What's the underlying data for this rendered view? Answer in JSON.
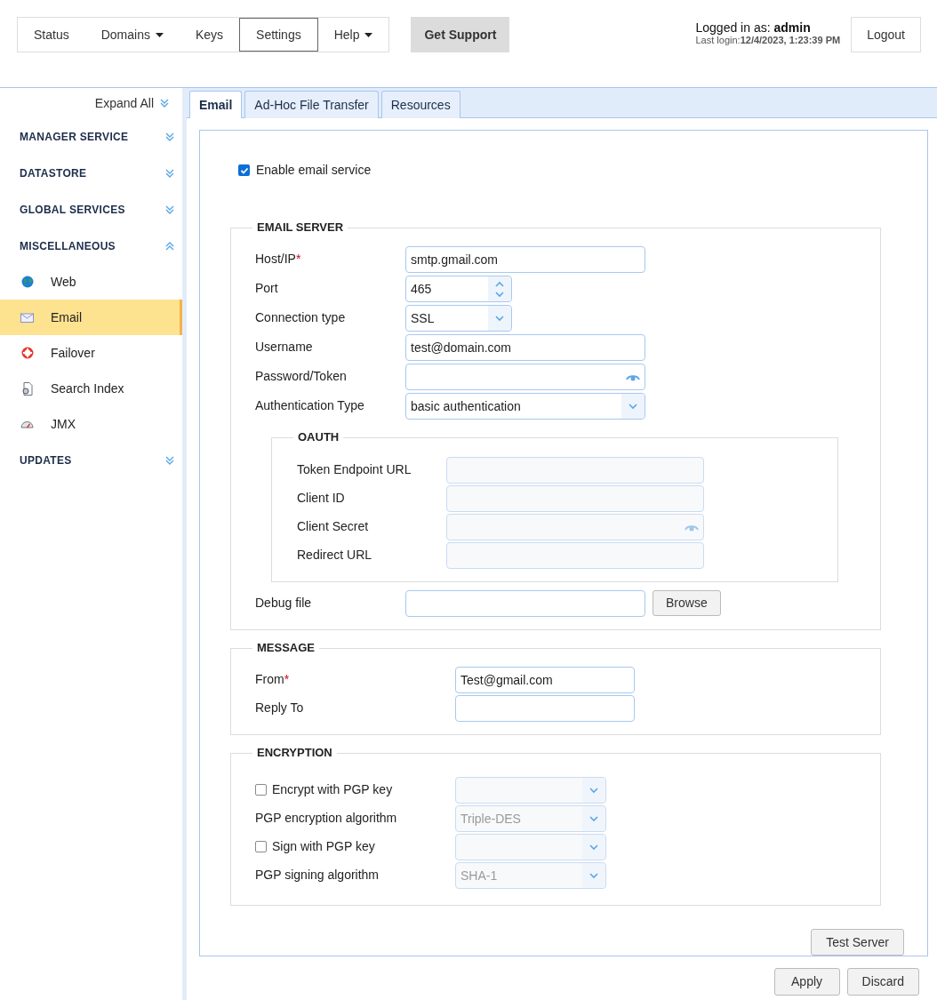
{
  "nav": {
    "items": [
      {
        "label": "Status",
        "selected": false,
        "menu": false
      },
      {
        "label": "Domains",
        "selected": false,
        "menu": true
      },
      {
        "label": "Keys",
        "selected": false,
        "menu": false
      },
      {
        "label": "Settings",
        "selected": true,
        "menu": false
      },
      {
        "label": "Help",
        "selected": false,
        "menu": true
      }
    ],
    "support": "Get Support"
  },
  "user": {
    "prefix": "Logged in as:",
    "name": "admin",
    "login_label": "Last login:",
    "login_time": "12/4/2023, 1:23:39 PM",
    "logout": "Logout"
  },
  "sidebar": {
    "expand_all": "Expand All",
    "sections": [
      {
        "title": "MANAGER SERVICE",
        "expanded": false
      },
      {
        "title": "DATASTORE",
        "expanded": false
      },
      {
        "title": "GLOBAL SERVICES",
        "expanded": false
      },
      {
        "title": "MISCELLANEOUS",
        "expanded": true,
        "items": [
          {
            "label": "Web",
            "selected": false
          },
          {
            "label": "Email",
            "selected": true
          },
          {
            "label": "Failover",
            "selected": false
          },
          {
            "label": "Search Index",
            "selected": false
          },
          {
            "label": "JMX",
            "selected": false
          }
        ]
      },
      {
        "title": "UPDATES",
        "expanded": false
      }
    ]
  },
  "required_mark": "*",
  "tabs": [
    {
      "label": "Email",
      "selected": true
    },
    {
      "label": "Ad-Hoc File Transfer",
      "selected": false
    },
    {
      "label": "Resources",
      "selected": false
    }
  ],
  "enable": {
    "label": "Enable email service",
    "checked": true
  },
  "email_server": {
    "legend": "EMAIL SERVER",
    "fields": [
      {
        "label": "Host/IP",
        "required": true,
        "kind": "text",
        "value": "smtp.gmail.com",
        "disabled": false
      },
      {
        "label": "Port",
        "required": false,
        "kind": "spinner",
        "value": "465",
        "disabled": false
      },
      {
        "label": "Connection type",
        "required": false,
        "kind": "short_select",
        "value": "SSL",
        "disabled": false
      },
      {
        "label": "Username",
        "required": false,
        "kind": "text",
        "value": "test@domain.com",
        "disabled": false
      },
      {
        "label": "Password/Token",
        "required": false,
        "kind": "password",
        "disabled": false
      },
      {
        "label": "Authentication Type",
        "required": false,
        "kind": "select",
        "value": "basic authentication",
        "disabled": false
      }
    ],
    "oauth": {
      "legend": "OAUTH",
      "fields": [
        {
          "label": "Token Endpoint URL",
          "required": false,
          "kind": "text",
          "disabled": true
        },
        {
          "label": "Client ID",
          "required": false,
          "kind": "text",
          "disabled": true
        },
        {
          "label": "Client Secret",
          "required": false,
          "kind": "password",
          "disabled": true
        },
        {
          "label": "Redirect URL",
          "required": false,
          "kind": "text",
          "disabled": true
        }
      ]
    },
    "debug_file": {
      "label": "Debug file",
      "button": "Browse"
    }
  },
  "message": {
    "legend": "MESSAGE",
    "fields": [
      {
        "label": "From",
        "required": true,
        "kind": "text",
        "value": "Test@gmail.com",
        "disabled": false
      },
      {
        "label": "Reply To",
        "required": false,
        "kind": "text",
        "disabled": false
      }
    ]
  },
  "encryption": {
    "legend": "ENCRYPTION",
    "fields": [
      {
        "label": "Encrypt with PGP key",
        "kind": "checkbox",
        "checked": false,
        "disabled": true
      },
      {
        "label": "PGP encryption algorithm",
        "kind": "select",
        "value": "Triple-DES",
        "disabled": true
      },
      {
        "label": "Sign with PGP key",
        "kind": "checkbox",
        "checked": false,
        "disabled": true
      },
      {
        "label": "PGP signing algorithm",
        "kind": "select",
        "value": "SHA-1",
        "disabled": true
      }
    ]
  },
  "test_button": "Test Server",
  "footer_buttons": [
    "Apply",
    "Discard"
  ]
}
